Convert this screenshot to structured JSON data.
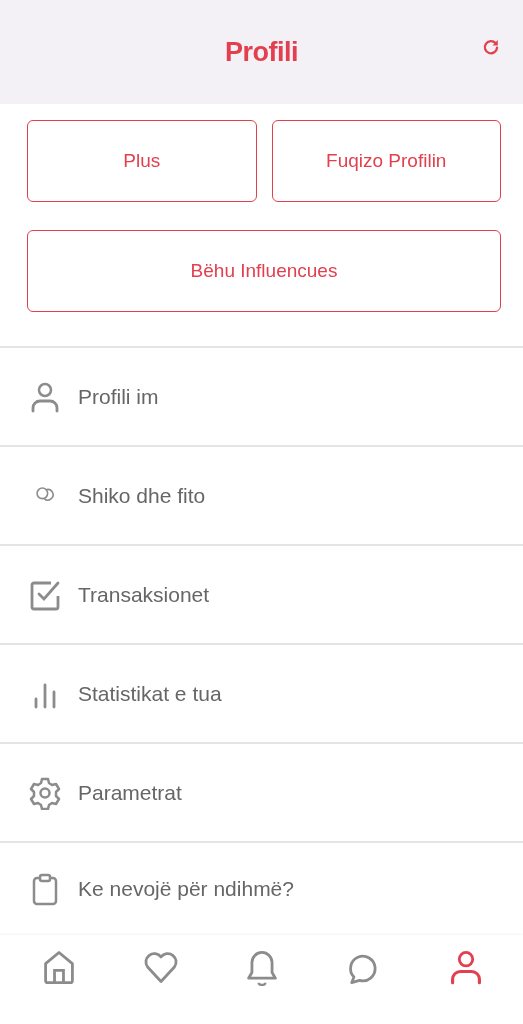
{
  "header": {
    "title": "Profili",
    "action": {
      "kind": "refresh"
    }
  },
  "buttons": [
    {
      "label": "Plus"
    },
    {
      "label": "Fuqizo Profilin"
    },
    {
      "label": "Bëhu Influencues"
    }
  ],
  "menu": [
    {
      "kind": "person",
      "label": "Profili im"
    },
    {
      "kind": "coins",
      "label": "Shiko dhe fito"
    },
    {
      "kind": "checkbox",
      "label": "Transaksionet"
    },
    {
      "kind": "bars",
      "label": "Statistikat e tua"
    },
    {
      "kind": "gear",
      "label": "Parametrat"
    },
    {
      "kind": "clipboard",
      "label": "Ke nevojë për ndihmë?"
    }
  ],
  "tab_bar": [
    {
      "kind": "home",
      "selected": false
    },
    {
      "kind": "heart",
      "selected": false
    },
    {
      "kind": "bell",
      "selected": false
    },
    {
      "kind": "chat",
      "selected": false
    },
    {
      "kind": "person",
      "selected": true
    }
  ]
}
